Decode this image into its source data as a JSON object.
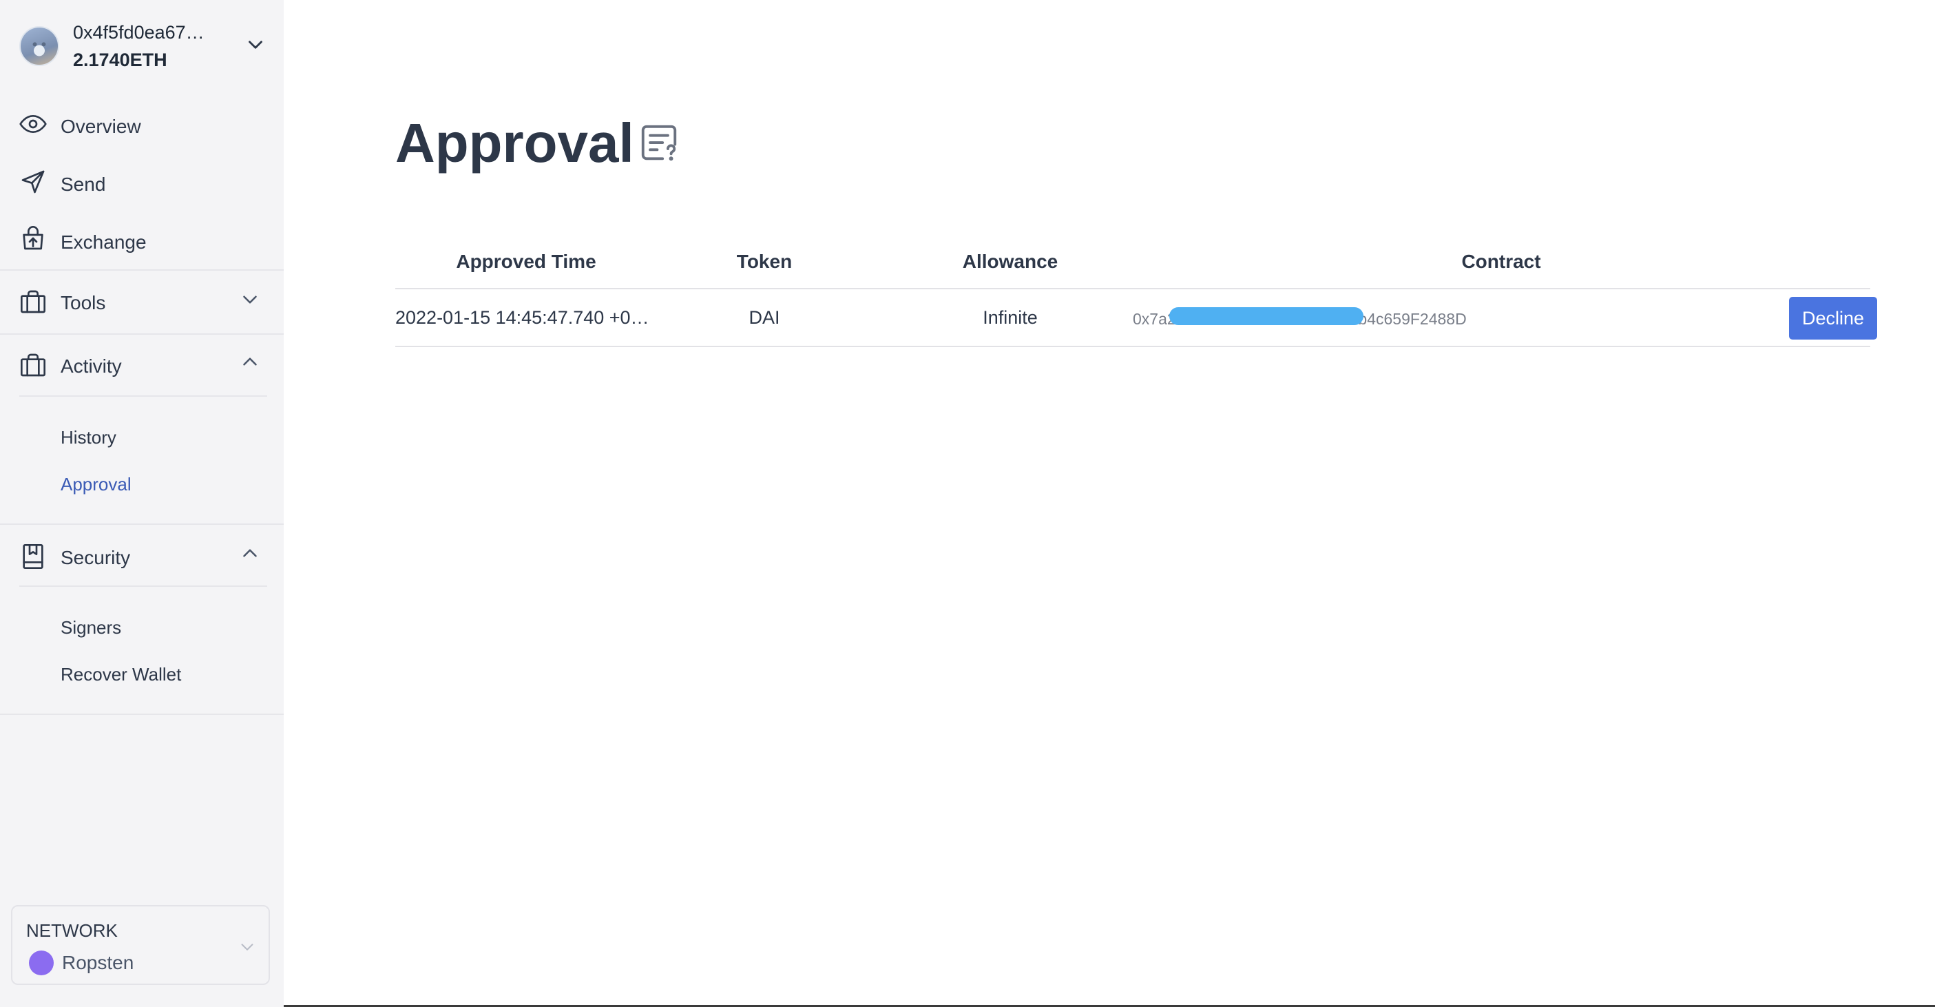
{
  "account": {
    "address": "0x4f5fd0ea67…",
    "balance": "2.1740ETH"
  },
  "sidebar": {
    "items": [
      {
        "label": "Overview",
        "icon": "eye-icon"
      },
      {
        "label": "Send",
        "icon": "send-icon"
      },
      {
        "label": "Exchange",
        "icon": "exchange-icon"
      },
      {
        "label": "Tools",
        "icon": "tools-icon",
        "expanded": false
      },
      {
        "label": "Activity",
        "icon": "activity-icon",
        "expanded": true,
        "children": [
          {
            "label": "History"
          },
          {
            "label": "Approval",
            "active": true
          }
        ]
      },
      {
        "label": "Security",
        "icon": "security-icon",
        "expanded": true,
        "children": [
          {
            "label": "Signers"
          },
          {
            "label": "Recover Wallet"
          }
        ]
      }
    ]
  },
  "network": {
    "caption": "NETWORK",
    "name": "Ropsten",
    "dot_color": "#8b6cf0"
  },
  "main": {
    "title": "Approval",
    "title_icon": "document-question-icon"
  },
  "table": {
    "headers": [
      "Approved Time",
      "Token",
      "Allowance",
      "Contract"
    ],
    "rows": [
      {
        "approved_time": "2022-01-15 14:45:47.740 +0…",
        "token": "DAI",
        "allowance": "Infinite",
        "contract_prefix": "0x7a2",
        "contract_suffix": "5dAcb4c659F2488D",
        "action": "Decline"
      }
    ]
  },
  "colors": {
    "accent": "#4a74e0",
    "active_link": "#3b5bb5",
    "sidebar_bg": "#f4f4f6",
    "redaction": "#4fb0f2"
  }
}
